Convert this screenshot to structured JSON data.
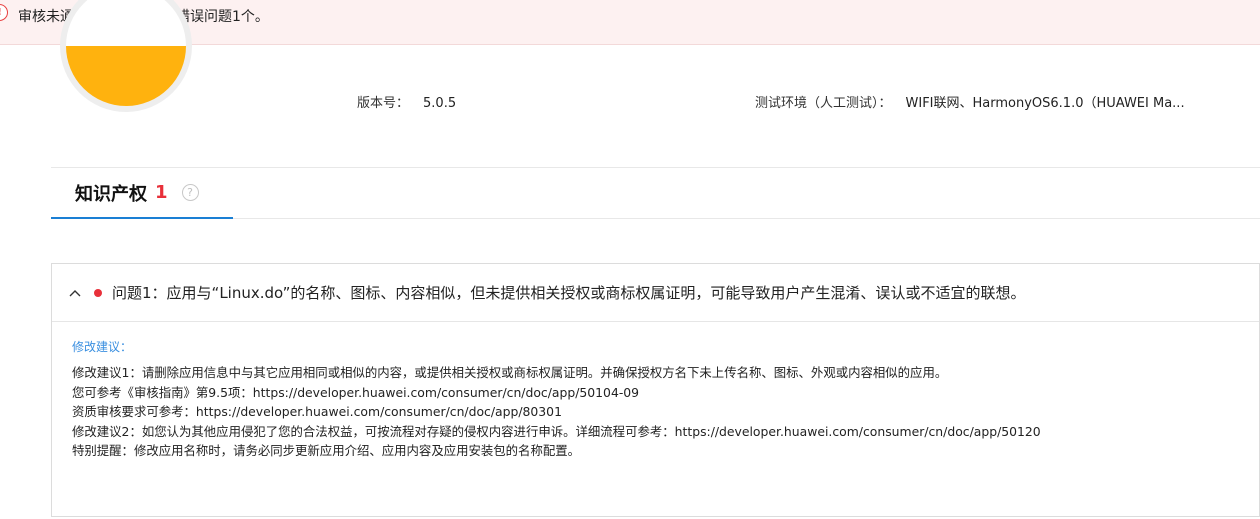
{
  "banner": {
    "warning_icon": "!",
    "text_before": "审核未通过，共检测出",
    "text_after": "错误问题1个。",
    "dot_color": "#e8303a"
  },
  "app_info": {
    "version_label": "版本号：",
    "version_value": "5.0.5",
    "env_label": "测试环境（人工测试）：",
    "env_value": "WIFI联网、HarmonyOS6.1.0（HUAWEI Ma..."
  },
  "tabs": [
    {
      "label": "知识产权",
      "count": "1",
      "help_icon": "?"
    }
  ],
  "issue": {
    "title": "问题1：应用与“Linux.do”的名称、图标、内容相似，但未提供相关授权或商标权属证明，可能导致用户产生混淆、误认或不适宜的联想。",
    "suggestion_title": "修改建议：",
    "lines": [
      "修改建议1：请删除应用信息中与其它应用相同或相似的内容，或提供相关授权或商标权属证明。并确保授权方名下未上传名称、图标、外观或内容相似的应用。",
      "您可参考《审核指南》第9.5项：https://developer.huawei.com/consumer/cn/doc/app/50104-09",
      "资质审核要求可参考：https://developer.huawei.com/consumer/cn/doc/app/80301",
      "修改建议2：如您认为其他应用侵犯了您的合法权益，可按流程对存疑的侵权内容进行申诉。详细流程可参考：https://developer.huawei.com/consumer/cn/doc/app/50120",
      "特别提醒：修改应用名称时，请务必同步更新应用介绍、应用内容及应用安装包的名称配置。"
    ]
  },
  "colors": {
    "accent": "#1a7fd4",
    "error": "#e8303a",
    "avatar_fill": "#ffb20e"
  }
}
